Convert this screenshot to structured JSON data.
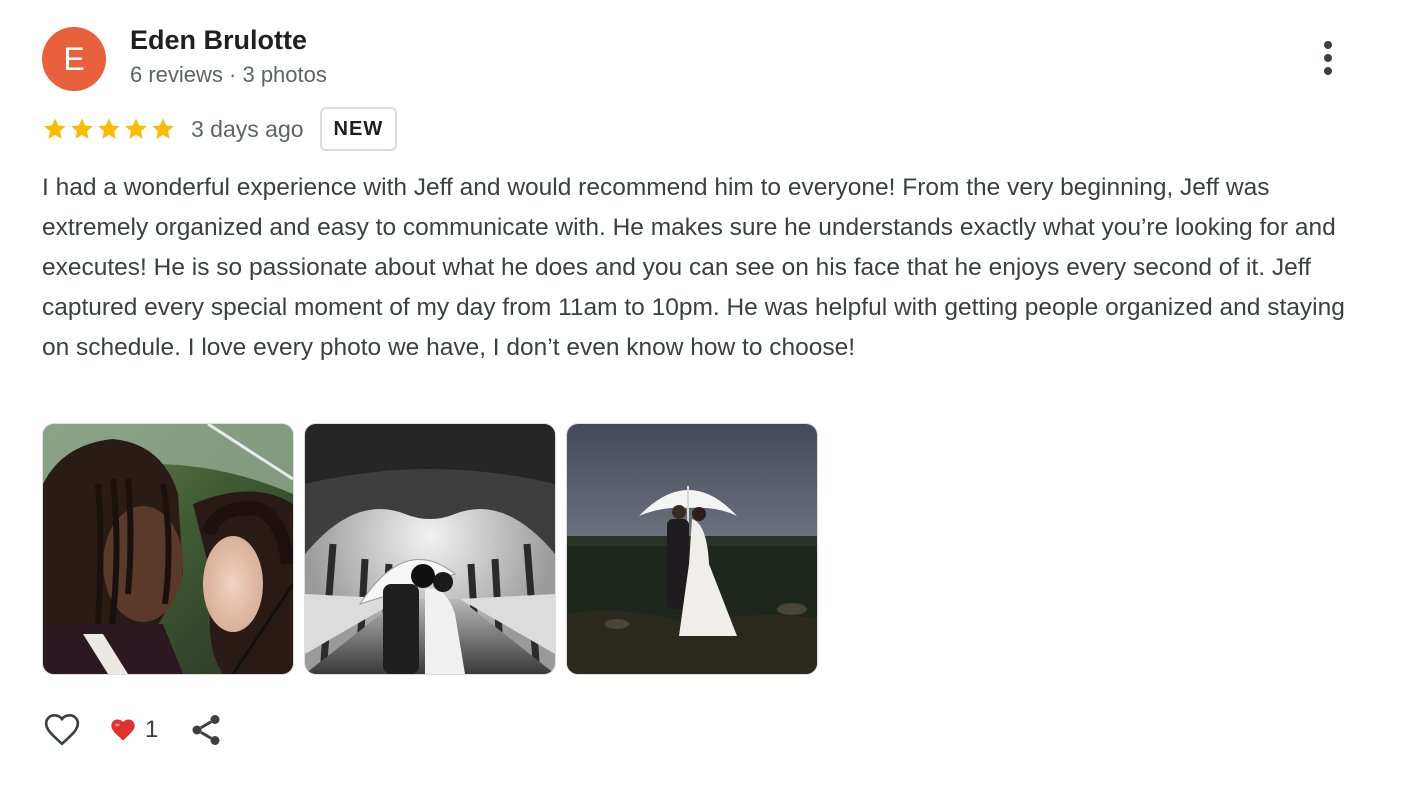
{
  "reviewer": {
    "initial": "E",
    "name": "Eden Brulotte",
    "meta": "6 reviews · 3 photos",
    "avatar_color": "#e8603c"
  },
  "rating": {
    "stars": 5,
    "max_stars": 5,
    "star_color": "#fbbc04",
    "date": "3 days ago",
    "badge": "NEW"
  },
  "review": {
    "text": "I had a wonderful experience with Jeff and would recommend him to everyone! From the very beginning, Jeff was extremely organized and easy to communicate with. He makes sure he understands exactly what you’re looking for and executes! He is so passionate about what he does and you can see on his face that he enjoys every second of it. Jeff captured every special moment of my day from 11am to 10pm. He was helpful with getting people organized and staying on schedule. I love every photo we have, I don’t even know how to choose!"
  },
  "photos": [
    {
      "icon": "couple-closeup-photo"
    },
    {
      "icon": "tree-lane-bw-photo"
    },
    {
      "icon": "couple-umbrella-dusk-photo"
    }
  ],
  "actions": {
    "like_icon": "heart-outline-icon",
    "reaction_icon": "red-heart-icon",
    "reaction_count": "1",
    "share_icon": "share-icon"
  },
  "more_icon": "more-vert-icon"
}
